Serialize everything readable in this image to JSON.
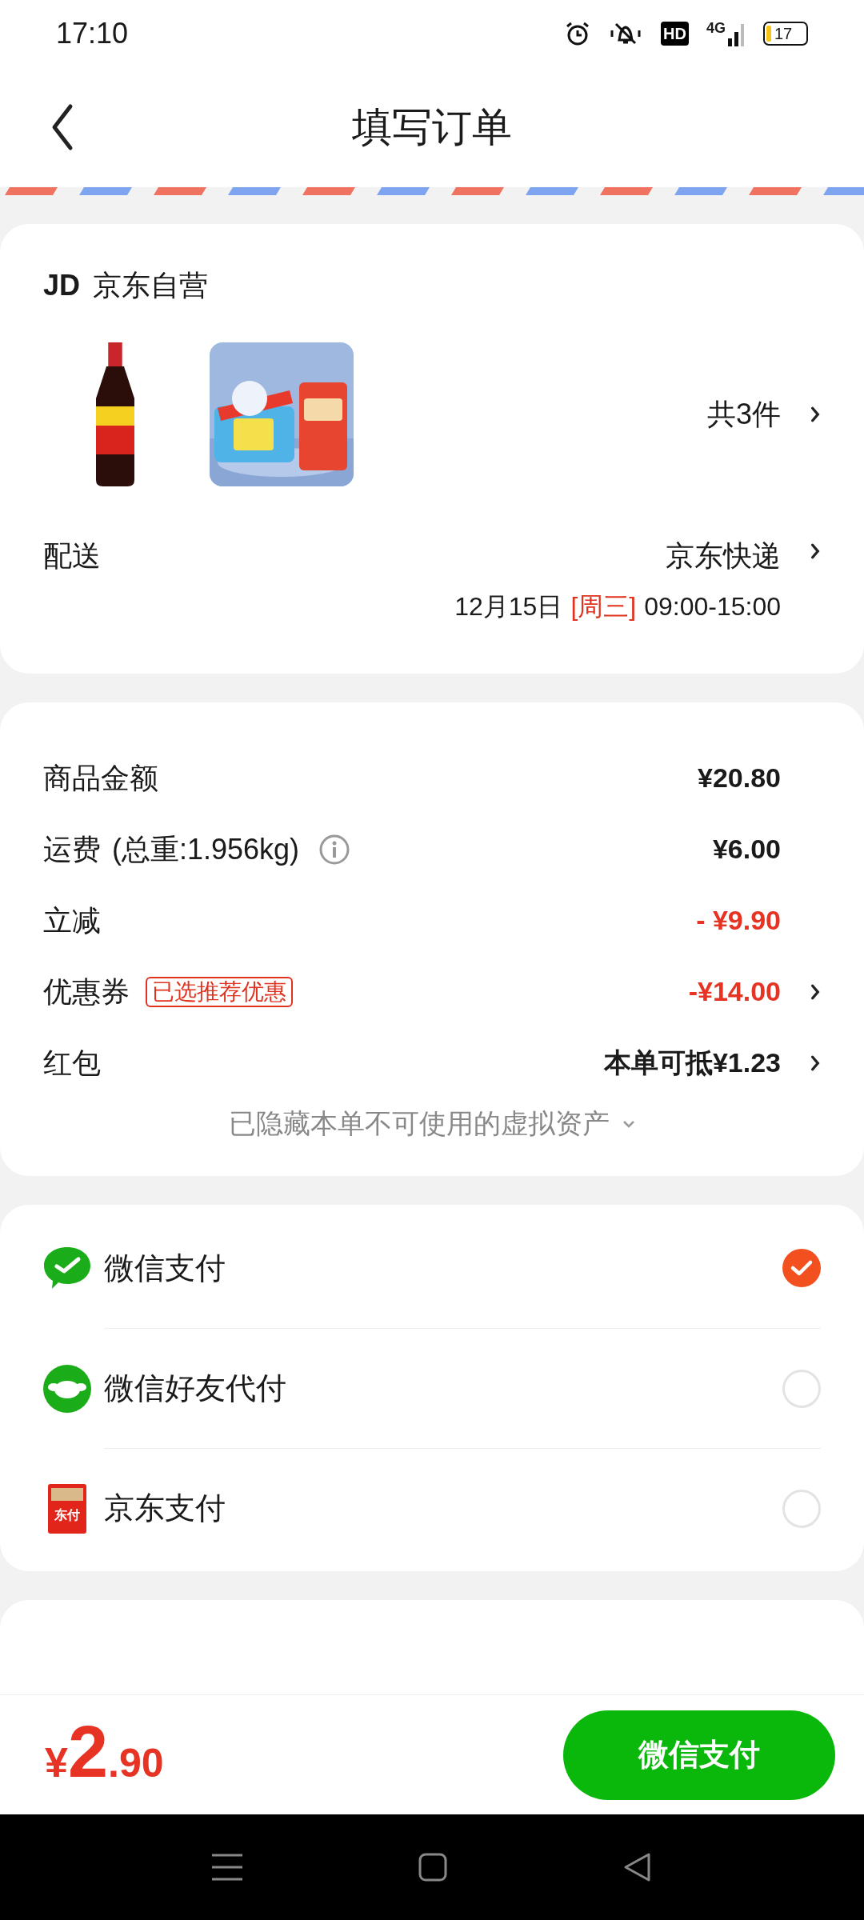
{
  "status_bar": {
    "time": "17:10",
    "hd": "HD",
    "network": "4G",
    "battery": "17"
  },
  "header": {
    "title": "填写订单"
  },
  "store": {
    "badge": "JD",
    "name": "京东自营",
    "count": "共3件"
  },
  "delivery": {
    "label": "配送",
    "carrier": "京东快递",
    "date": "12月15日",
    "weekday": "[周三]",
    "time": "09:00-15:00"
  },
  "fees": [
    {
      "label": "商品金额",
      "value": "¥20.80",
      "red": false,
      "arrow": false
    },
    {
      "label": "运费",
      "note": "(总重:1.956kg)",
      "info": true,
      "value": "¥6.00",
      "red": false,
      "arrow": false
    },
    {
      "label": "立减",
      "value": "- ¥9.90",
      "red": true,
      "arrow": false
    },
    {
      "label": "优惠券",
      "tag": "已选推荐优惠",
      "value": "-¥14.00",
      "red": true,
      "arrow": true
    },
    {
      "label": "红包",
      "value": "本单可抵¥1.23",
      "red": false,
      "arrow": true
    }
  ],
  "hidden_assets": "已隐藏本单不可使用的虚拟资产",
  "payments": [
    {
      "name": "微信支付",
      "kind": "wechat",
      "selected": true
    },
    {
      "name": "微信好友代付",
      "kind": "friend",
      "selected": false
    },
    {
      "name": "京东支付",
      "kind": "jdpay",
      "icon_text": "东付",
      "selected": false
    }
  ],
  "footer": {
    "currency": "¥",
    "integer": "2",
    "decimal": ".90",
    "pay_button": "微信支付"
  }
}
